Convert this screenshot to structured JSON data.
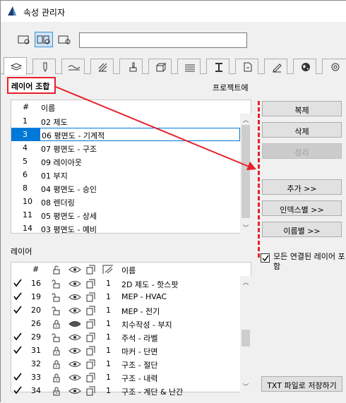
{
  "window": {
    "title": "속성 관리자"
  },
  "search": {
    "value": ""
  },
  "tabs": [
    "layers",
    "pen",
    "fill-lines",
    "composites",
    "profiles",
    "surfaces",
    "fills",
    "line-types",
    "zones",
    "materials",
    "world",
    "wheel"
  ],
  "section": {
    "combinations_label": "레이어 조합",
    "project_label": "프로젝트에"
  },
  "combinations": {
    "headers": {
      "num": "#",
      "name": "이름"
    },
    "rows": [
      {
        "num": "1",
        "name": "02 제도",
        "selected": false
      },
      {
        "num": "3",
        "name": "06 평면도 - 기계적",
        "selected": true
      },
      {
        "num": "4",
        "name": "07 평면도 - 구조",
        "selected": false
      },
      {
        "num": "5",
        "name": "09 레이아웃",
        "selected": false
      },
      {
        "num": "6",
        "name": "01 부지",
        "selected": false
      },
      {
        "num": "8",
        "name": "04 평면도 - 승인",
        "selected": false
      },
      {
        "num": "10",
        "name": "08 렌더링",
        "selected": false
      },
      {
        "num": "11",
        "name": "05 평면도 - 상세",
        "selected": false
      },
      {
        "num": "14",
        "name": "03 평면도 - 예비",
        "selected": false
      }
    ]
  },
  "buttons": {
    "duplicate": "복제",
    "delete": "삭제",
    "cleanup": "정리",
    "add": "추가 >>",
    "by_index": "인덱스별 >>",
    "by_name": "이름별 >>",
    "save_txt": "TXT 파일로 저장하기"
  },
  "layers": {
    "label": "레이어",
    "headers": {
      "num": "#",
      "name": "이름"
    },
    "include_all_label": "모든 연결된 레이어 포함",
    "include_all_checked": true,
    "rows": [
      {
        "checked": true,
        "num": "16",
        "lock": "open",
        "visible": true,
        "pen": "1",
        "name": "2D 제도 - 핫스팟"
      },
      {
        "checked": true,
        "num": "19",
        "lock": "open",
        "visible": true,
        "pen": "1",
        "name": "MEP - HVAC"
      },
      {
        "checked": true,
        "num": "20",
        "lock": "open",
        "visible": true,
        "pen": "1",
        "name": "MEP - 전기"
      },
      {
        "checked": false,
        "num": "26",
        "lock": "closed",
        "visible": false,
        "pen": "1",
        "name": "치수작성 - 부지"
      },
      {
        "checked": true,
        "num": "29",
        "lock": "open",
        "visible": true,
        "pen": "1",
        "name": "주석 - 라벨"
      },
      {
        "checked": true,
        "num": "31",
        "lock": "closed",
        "visible": true,
        "pen": "1",
        "name": "마커 - 단면"
      },
      {
        "checked": false,
        "num": "32",
        "lock": "closed",
        "visible": true,
        "pen": "1",
        "name": "구조 - 절단"
      },
      {
        "checked": true,
        "num": "33",
        "lock": "closed",
        "visible": true,
        "pen": "1",
        "name": "구조 - 내력"
      },
      {
        "checked": true,
        "num": "34",
        "lock": "closed",
        "visible": true,
        "pen": "1",
        "name": "구조 - 계단 & 난간"
      }
    ]
  },
  "colors": {
    "annotation_red": "#e8202a",
    "selection_blue": "#0078d7"
  }
}
